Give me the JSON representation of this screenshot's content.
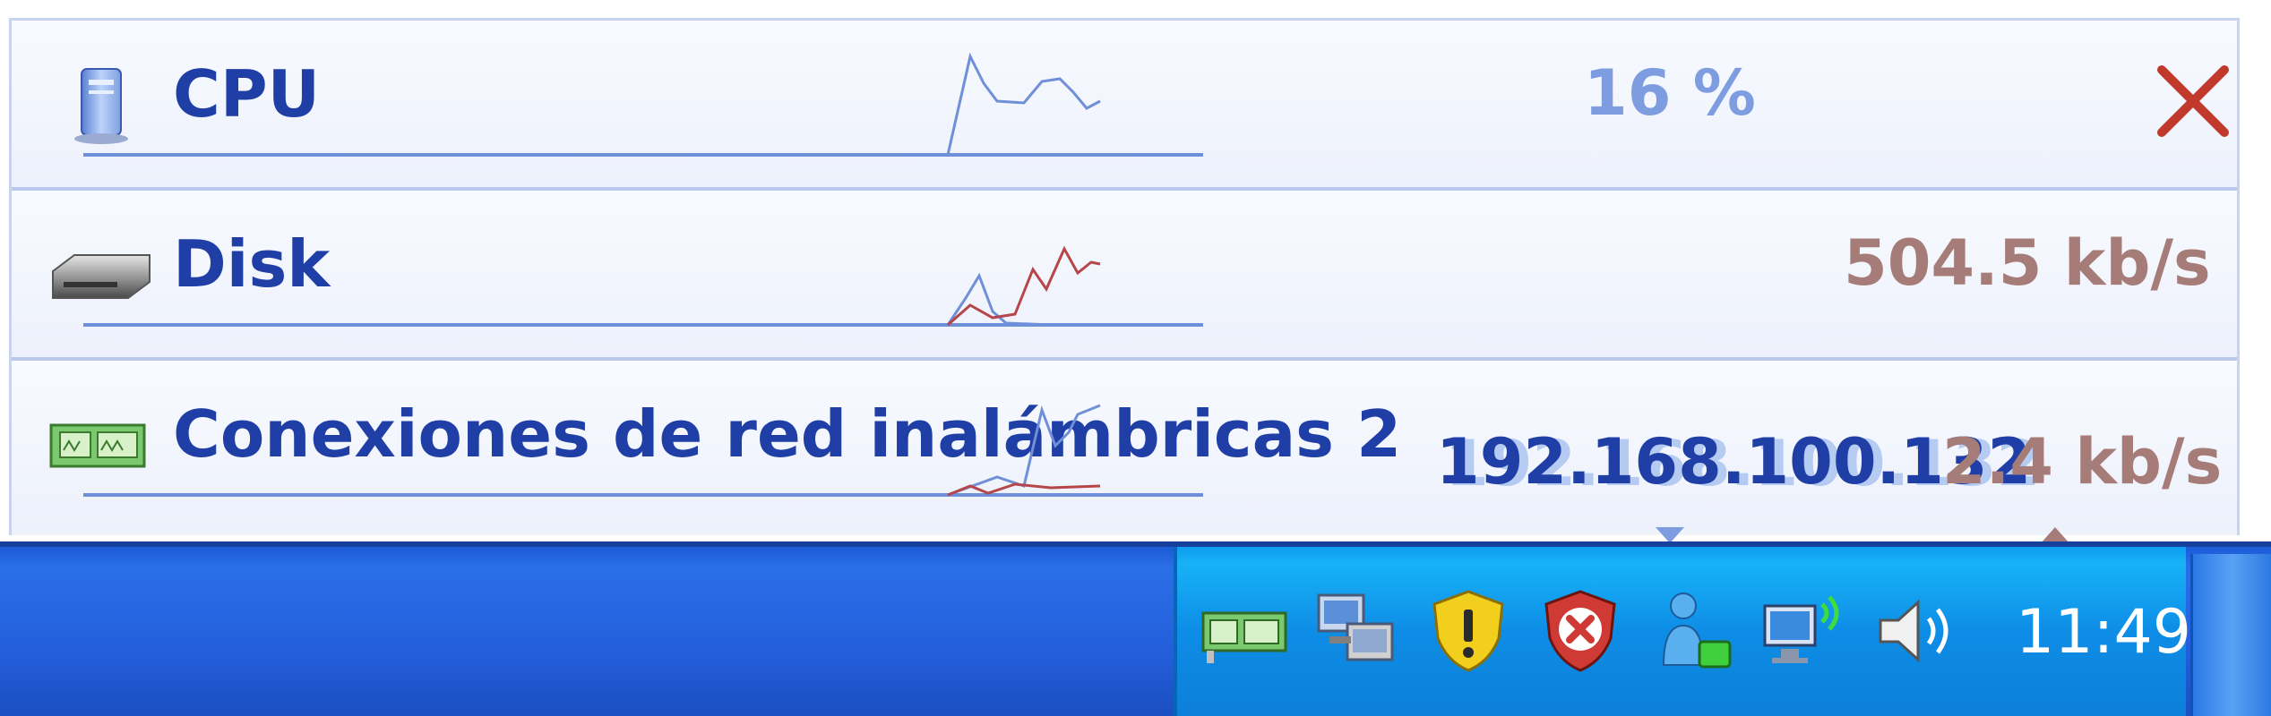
{
  "monitor": {
    "close_icon": "close-icon",
    "rows": [
      {
        "label": "CPU",
        "icon": "computer-tower-icon",
        "value": "16 %",
        "value_color": "#7e9ce0"
      },
      {
        "label": "Disk",
        "icon": "hard-drive-icon",
        "value": "504.5 kb/s",
        "value_color": "#a67c78"
      },
      {
        "label": "Conexiones de red inalámbricas 2",
        "icon": "network-card-icon",
        "ip": "192.168.100.132",
        "value": "2.4 kb/s",
        "value_color": "#a67c78"
      }
    ]
  },
  "taskbar": {
    "clock": "11:49",
    "tray_icons": [
      "network-card-icon",
      "network-computers-icon",
      "security-warning-shield-icon",
      "security-alert-shield-icon",
      "messenger-user-icon",
      "wireless-network-icon",
      "speaker-volume-icon"
    ]
  },
  "colors": {
    "label": "#1f3ea6",
    "cpu_line": "#6f8fd8",
    "disk_write_line": "#b5474a",
    "taskbar": "#245fdc",
    "tray": "#0e8de6"
  }
}
